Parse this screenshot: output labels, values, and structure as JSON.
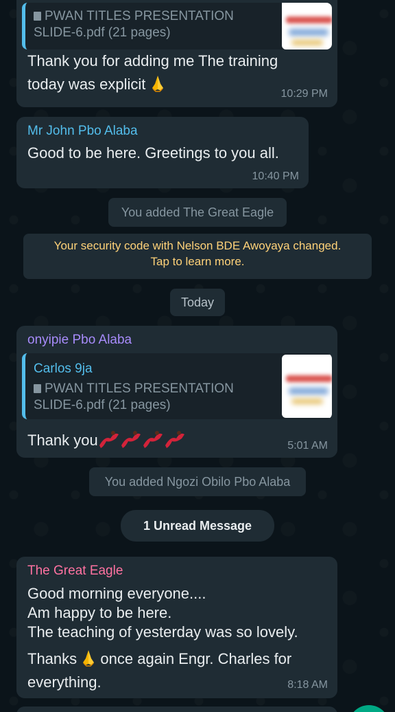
{
  "messages": {
    "m1": {
      "quote_doc_line1": "PWAN TITLES PRESENTATION",
      "quote_doc_line2": "SLIDE-6.pdf (21 pages)",
      "text_line1": "Thank you for adding me  The training",
      "text_line2": "today was explicit",
      "emoji": "folded-hands-icon",
      "time": "10:29 PM"
    },
    "m2": {
      "sender": "Mr John Pbo Alaba",
      "sender_color": "#53bdeb",
      "text": "Good to be here.  Greetings to you all.",
      "time": "10:40 PM"
    },
    "m3": {
      "sender": "onyipie Pbo Alaba",
      "sender_color": "#a78bfa",
      "quote_sender": "Carlos 9ja",
      "quote_doc_line1": "PWAN TITLES PRESENTATION",
      "quote_doc_line2": "SLIDE-6.pdf (21 pages)",
      "text": "Thank you",
      "emoji": "dancer-icon",
      "time": "5:01 AM"
    },
    "m4": {
      "sender": "The Great Eagle",
      "sender_color": "#ff72a1",
      "line1": "Good morning everyone....",
      "line2": "Am happy to be here.",
      "line3": "The teaching of yesterday was so lovely.",
      "line4_a": "Thanks",
      "line4_b": "once again Engr. Charles for",
      "line5": "everything.",
      "time": "8:18 AM"
    }
  },
  "system": {
    "added_eagle": "You added The Great Eagle",
    "security_line1": "Your security code with Nelson BDE Awoyaya changed.",
    "security_line2": "Tap to learn more.",
    "date_chip": "Today",
    "added_ngozi": "You added Ngozi Obilo Pbo Alaba",
    "unread": "1 Unread Message"
  },
  "colors": {
    "background": "#0b141a",
    "bubble": "#1f2c34",
    "security_text": "#ffd279",
    "fab": "#00a884"
  }
}
